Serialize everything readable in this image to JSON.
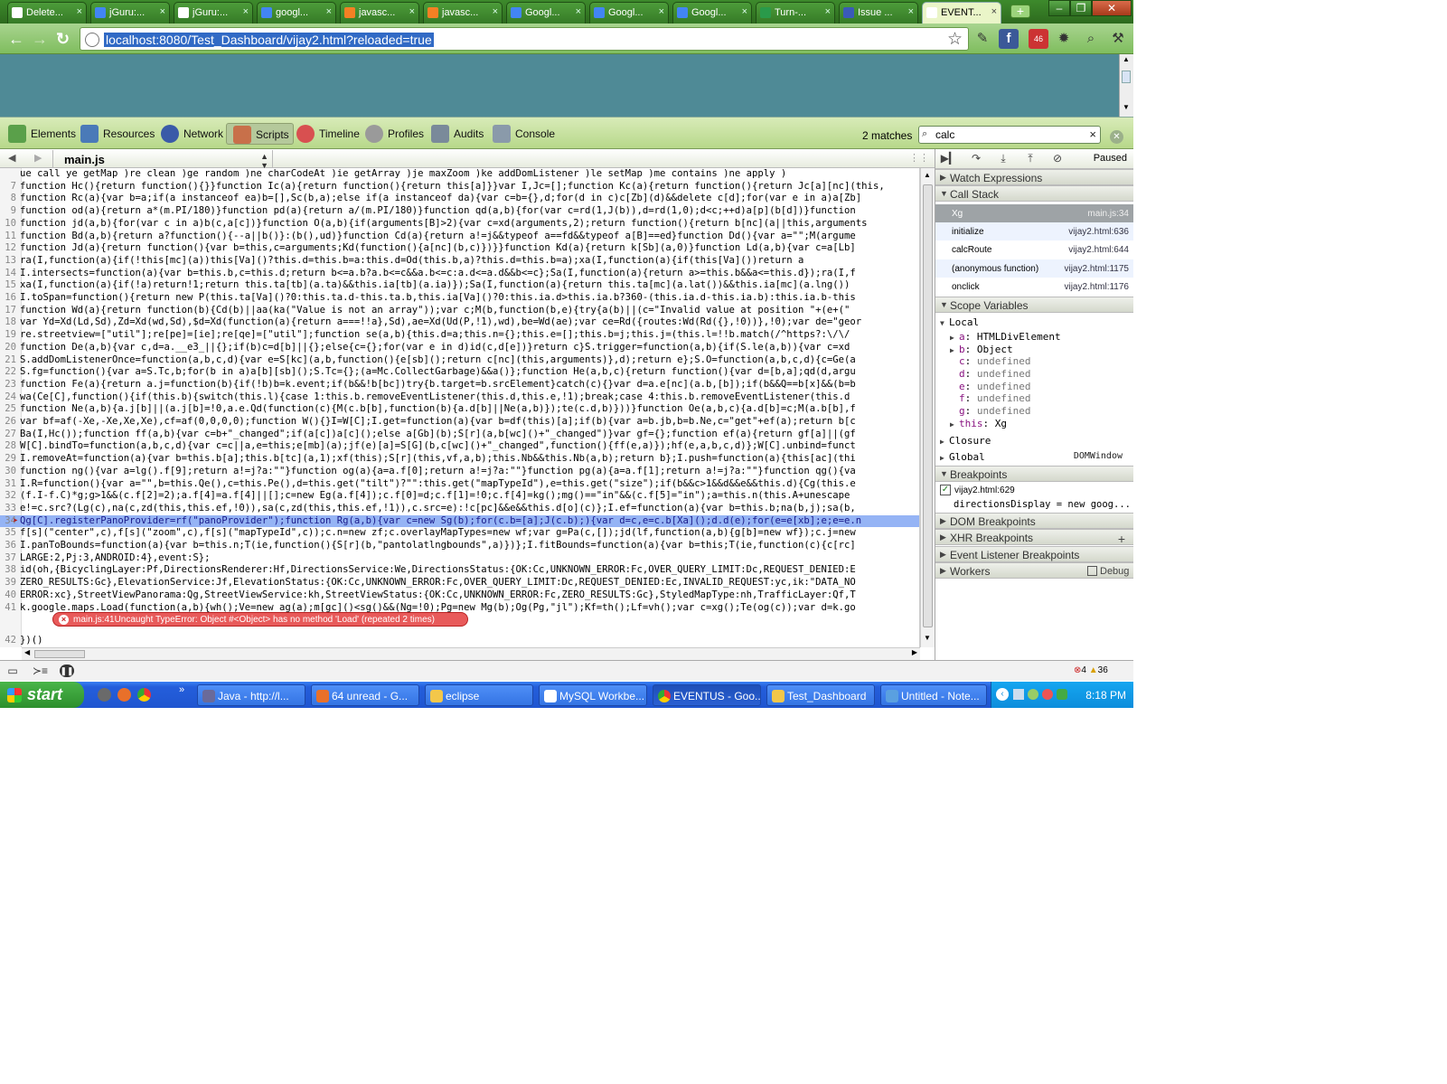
{
  "browser": {
    "tabs": [
      {
        "title": "Delete...",
        "icon": "page-icon",
        "color": "#ffffff",
        "active": false
      },
      {
        "title": "jGuru:...",
        "icon": "google-icon",
        "color": "#4285f4",
        "active": false
      },
      {
        "title": "jGuru:...",
        "icon": "page-icon",
        "color": "#ffffff",
        "active": false
      },
      {
        "title": "googl...",
        "icon": "google-icon",
        "color": "#4285f4",
        "active": false
      },
      {
        "title": "javasc...",
        "icon": "stackoverflow-icon",
        "color": "#f48024",
        "active": false
      },
      {
        "title": "javasc...",
        "icon": "stackoverflow-icon",
        "color": "#f48024",
        "active": false
      },
      {
        "title": "Googl...",
        "icon": "google-icon",
        "color": "#4285f4",
        "active": false
      },
      {
        "title": "Googl...",
        "icon": "google-icon",
        "color": "#4285f4",
        "active": false
      },
      {
        "title": "Googl...",
        "icon": "google-icon",
        "color": "#4285f4",
        "active": false
      },
      {
        "title": "Turn-...",
        "icon": "plus-icon",
        "color": "#2a9a4a",
        "active": false
      },
      {
        "title": "Issue ...",
        "icon": "issue-icon",
        "color": "#3a5ab8",
        "active": false
      },
      {
        "title": "EVENT...",
        "icon": "page-icon",
        "color": "#ffffff",
        "active": true
      }
    ],
    "url": "localhost:8080/Test_Dashboard/vijay2.html?reloaded=true",
    "ext_badge": "46"
  },
  "devtools": {
    "panels": [
      "Elements",
      "Resources",
      "Network",
      "Scripts",
      "Timeline",
      "Profiles",
      "Audits",
      "Console"
    ],
    "selected_panel": "Scripts",
    "matches": "2 matches",
    "search_value": "calc",
    "file": "main.js",
    "code_lines": [
      {
        "n": "",
        "t": "ue  call ye  getMap )re  clean )ge  random )ne  charCodeAt )ie  getArray )je  maxZoom )ke  addDomListener )le  setMap )me  contains )ne  apply )"
      },
      {
        "n": "7",
        "t": "function Hc(){return function(){}}function Ic(a){return function(){return this[a]}}var I,Jc=[];function Kc(a){return function(){return Jc[a][nc](this,"
      },
      {
        "n": "8",
        "t": "function Rc(a){var b=a;if(a instanceof ea)b=[],Sc(b,a);else if(a instanceof da){var c=b={},d;for(d in c)c[Zb](d)&&delete c[d];for(var e in a)a[Zb]"
      },
      {
        "n": "9",
        "t": "function od(a){return a*(m.PI/180)}function pd(a){return a/(m.PI/180)}function qd(a,b){for(var c=rd(1,J(b)),d=rd(1,0);d<c;++d)a[p](b[d])}function"
      },
      {
        "n": "10",
        "t": "function jd(a,b){for(var c in a)b(c,a[c])}function O(a,b){if(arguments[B]>2){var c=xd(arguments,2);return function(){return b[nc](a||this,arguments"
      },
      {
        "n": "11",
        "t": "function Bd(a,b){return a?function(){--a||b()}:(b(),ud)}function Cd(a){return a!=j&&typeof a==fd&&typeof a[B]==ed}function Dd(){var a=\"\";M(argume"
      },
      {
        "n": "12",
        "t": "function Jd(a){return function(){var b=this,c=arguments;Kd(function(){a[nc](b,c)})}}function Kd(a){return k[Sb](a,0)}function Ld(a,b){var c=a[Lb]"
      },
      {
        "n": "13",
        "t": "ra(I,function(a){if(!this[mc](a))this[Va]()?this.d=this.b=a:this.d=Od(this.b,a)?this.d=this.b=a);xa(I,function(a){if(this[Va]())return a"
      },
      {
        "n": "14",
        "t": "I.intersects=function(a){var b=this.b,c=this.d;return b<=a.b?a.b<=c&&a.b<=c:a.d<=a.d&&b<=c};Sa(I,function(a){return a>=this.b&&a<=this.d});ra(I,f"
      },
      {
        "n": "15",
        "t": "xa(I,function(a){if(!a)return!1;return this.ta[tb](a.ta)&&this.ia[tb](a.ia)});Sa(I,function(a){return this.ta[mc](a.lat())&&this.ia[mc](a.lng())"
      },
      {
        "n": "16",
        "t": "I.toSpan=function(){return new P(this.ta[Va]()?0:this.ta.d-this.ta.b,this.ia[Va]()?0:this.ia.d>this.ia.b?360-(this.ia.d-this.ia.b):this.ia.b-this"
      },
      {
        "n": "17",
        "t": "function Wd(a){return function(b){Cd(b)||aa(ka(\"Value is not an array\"));var c;M(b,function(b,e){try{a(b)||(c=\"Invalid value at position \"+(e+(\""
      },
      {
        "n": "18",
        "t": "var Yd=Xd(Ld,Sd),Zd=Xd(wd,Sd),$d=Xd(function(a){return a===!!a},Sd),ae=Xd(Ud(P,!1),wd),be=Wd(ae);var ce=Rd({routes:Wd(Rd({},!0))},!0);var de=\"geor"
      },
      {
        "n": "19",
        "t": "re.streetview=[\"util\"];re[pe]=[ie];re[qe]=[\"util\"];function se(a,b){this.d=a;this.n={};this.e=[];this.b=j;this.j=(this.l=!!b.match(/^https?:\\/\\/"
      },
      {
        "n": "20",
        "t": "function De(a,b){var c,d=a.__e3_||{};if(b)c=d[b]||{};else{c={};for(var e in d)id(c,d[e])}return c}S.trigger=function(a,b){if(S.le(a,b)){var c=xd"
      },
      {
        "n": "21",
        "t": "S.addDomListenerOnce=function(a,b,c,d){var e=S[kc](a,b,function(){e[sb]();return c[nc](this,arguments)},d);return e};S.O=function(a,b,c,d){c=Ge(a"
      },
      {
        "n": "22",
        "t": "S.fg=function(){var a=S.Tc,b;for(b in a)a[b][sb]();S.Tc={};(a=Mc.CollectGarbage)&&a()};function He(a,b,c){return function(){var d=[b,a];qd(d,argu"
      },
      {
        "n": "23",
        "t": "function Fe(a){return a.j=function(b){if(!b)b=k.event;if(b&&!b[bc])try{b.target=b.srcElement}catch(c){}var d=a.e[nc](a.b,[b]);if(b&&Q==b[x]&&(b=b"
      },
      {
        "n": "24",
        "t": "wa(Ce[C],function(){if(this.b){switch(this.l){case 1:this.b.removeEventListener(this.d,this.e,!1);break;case 4:this.b.removeEventListener(this.d"
      },
      {
        "n": "25",
        "t": "function Ne(a,b){a.j[b]||(a.j[b]=!0,a.e.Qd(function(c){M(c.b[b],function(b){a.d[b]||Ne(a,b)});te(c.d,b)}))}function Oe(a,b,c){a.d[b]=c;M(a.b[b],f"
      },
      {
        "n": "26",
        "t": "var bf=af(-Xe,-Xe,Xe,Xe),cf=af(0,0,0,0);function W(){}I=W[C];I.get=function(a){var b=df(this)[a];if(b){var a=b.jb,b=b.Ne,c=\"get\"+ef(a);return b[c"
      },
      {
        "n": "27",
        "t": "Ba(I,Hc());function ff(a,b){var c=b+\"_changed\";if(a[c])a[c]();else a[Gb](b);S[r](a,b[wc]()+\"_changed\")}var gf={};function ef(a){return gf[a]||(gf"
      },
      {
        "n": "28",
        "t": "W[C].bindTo=function(a,b,c,d){var c=c||a,e=this;e[mb](a);jf(e)[a]=S[G](b,c[wc]()+\"_changed\",function(){ff(e,a)});hf(e,a,b,c,d)};W[C].unbind=funct"
      },
      {
        "n": "29",
        "t": "I.removeAt=function(a){var b=this.b[a];this.b[tc](a,1);xf(this);S[r](this,vf,a,b);this.Nb&&this.Nb(a,b);return b};I.push=function(a){this[ac](thi"
      },
      {
        "n": "30",
        "t": "function ng(){var a=lg().f[9];return a!=j?a:\"\"}function og(a){a=a.f[0];return a!=j?a:\"\"}function pg(a){a=a.f[1];return a!=j?a:\"\"}function qg(){va"
      },
      {
        "n": "31",
        "t": "I.R=function(){var a=\"\",b=this.Qe(),c=this.Pe(),d=this.get(\"tilt\")?\"\":this.get(\"mapTypeId\"),e=this.get(\"size\");if(b&&c>1&&d&&e&&this.d){Cg(this.e"
      },
      {
        "n": "32",
        "t": "(f.I-f.C)*g;g>1&&(c.f[2]=2);a.f[4]=a.f[4]||[];c=new Eg(a.f[4]);c.f[0]=d;c.f[1]=!0;c.f[4]=kg();mg()==\"in\"&&(c.f[5]=\"in\");a=this.n(this.A+unescape"
      },
      {
        "n": "33",
        "t": "e!=c.src?(Lg(c),na(c,zd(this,this.ef,!0)),sa(c,zd(this,this.ef,!1)),c.src=e):!c[pc]&&e&&this.d[o](c)};I.ef=function(a){var b=this.b;na(b,j);sa(b,"
      },
      {
        "n": "34",
        "t": "Qg[C].registerPanoProvider=rf(\"panoProvider\");function Rg(a,b){var c=new Sg(b);for(c.b=[a];J(c.b);){var d=c,e=c.b[Xa]();d.d(e);for(e=e[xb];e;e=e.n",
        "hl": true
      },
      {
        "n": "35",
        "t": "f[s](\"center\",c),f[s](\"zoom\",c),f[s](\"mapTypeId\",c));c.n=new zf;c.overlayMapTypes=new wf;var g=Pa(c,[]);jd(lf,function(a,b){g[b]=new wf});c.j=new"
      },
      {
        "n": "36",
        "t": "I.panToBounds=function(a){var b=this.n;T(ie,function(){S[r](b,\"pantolatlngbounds\",a)})};I.fitBounds=function(a){var b=this;T(ie,function(c){c[rc]"
      },
      {
        "n": "37",
        "t": "LARGE:2,Pj:3,ANDROID:4},event:S};"
      },
      {
        "n": "38",
        "t": "id(oh,{BicyclingLayer:Pf,DirectionsRenderer:Hf,DirectionsService:We,DirectionsStatus:{OK:Cc,UNKNOWN_ERROR:Fc,OVER_QUERY_LIMIT:Dc,REQUEST_DENIED:E"
      },
      {
        "n": "39",
        "t": "ZERO_RESULTS:Gc},ElevationService:Jf,ElevationStatus:{OK:Cc,UNKNOWN_ERROR:Fc,OVER_QUERY_LIMIT:Dc,REQUEST_DENIED:Ec,INVALID_REQUEST:yc,ik:\"DATA_NO"
      },
      {
        "n": "40",
        "t": "ERROR:xc},StreetViewPanorama:Qg,StreetViewService:kh,StreetViewStatus:{OK:Cc,UNKNOWN_ERROR:Fc,ZERO_RESULTS:Gc},StyledMapType:nh,TrafficLayer:Qf,T"
      },
      {
        "n": "41",
        "t": "k.google.maps.Load(function(a,b){wh();Ve=new ag(a);m[gc]()<sg()&&(Ng=!0);Pg=new Mg(b);Og(Pg,\"jl\");Kf=th();Lf=vh();var c=xg();Te(og(c));var d=k.go"
      },
      {
        "n": "42",
        "t": "})()"
      }
    ],
    "error_message": "main.js:41Uncaught TypeError: Object #<Object> has no method 'Load' (repeated 2 times)",
    "paused_label": "Paused",
    "sections": {
      "watch": "Watch Expressions",
      "callstack": "Call Stack",
      "scope": "Scope Variables",
      "breakpoints": "Breakpoints",
      "dom_bp": "DOM Breakpoints",
      "xhr_bp": "XHR Breakpoints",
      "event_bp": "Event Listener Breakpoints",
      "workers": "Workers",
      "debug_label": "Debug"
    },
    "call_stack": [
      {
        "fn": "Xg",
        "loc": "main.js:34",
        "selected": true
      },
      {
        "fn": "initialize",
        "loc": "vijay2.html:636"
      },
      {
        "fn": "calcRoute",
        "loc": "vijay2.html:644"
      },
      {
        "fn": "(anonymous function)",
        "loc": "vijay2.html:1175"
      },
      {
        "fn": "onclick",
        "loc": "vijay2.html:1176"
      }
    ],
    "scope": {
      "local": "Local",
      "vars": [
        {
          "k": "a",
          "v": "HTMLDivElement",
          "expandable": true
        },
        {
          "k": "b",
          "v": "Object",
          "expandable": true
        },
        {
          "k": "c",
          "v": "undefined"
        },
        {
          "k": "d",
          "v": "undefined"
        },
        {
          "k": "e",
          "v": "undefined"
        },
        {
          "k": "f",
          "v": "undefined"
        },
        {
          "k": "g",
          "v": "undefined"
        },
        {
          "k": "this",
          "v": "Xg",
          "expandable": true
        }
      ],
      "closure": "Closure",
      "global": "Global",
      "global_value": "DOMWindow"
    },
    "breakpoint": {
      "file": "vijay2.html:629",
      "code": "directionsDisplay = new goog..."
    },
    "error_count": "4",
    "warning_count": "36"
  },
  "taskbar": {
    "start_label": "start",
    "items": [
      {
        "label": "Java - http://l...",
        "color": "#6a6a9a"
      },
      {
        "label": "64 unread - G...",
        "color": "#e8702a"
      },
      {
        "label": "eclipse",
        "color": "#f3c74a"
      },
      {
        "label": "MySQL Workbe...",
        "color": "#fff"
      },
      {
        "label": "EVENTUS - Goo...",
        "color": "#4caf50",
        "active": true
      },
      {
        "label": "Test_Dashboard",
        "color": "#f3c74a"
      },
      {
        "label": "Untitled - Note...",
        "color": "#5aa0e0"
      }
    ],
    "clock": "8:18 PM"
  },
  "colors": {
    "chrome_green": "#3d8a2c",
    "page_bg": "#4f8a96",
    "devtools_bar": "#c7e2a1",
    "highlight_line": "#95b4f5",
    "error_bubble": "#e85a5a",
    "taskbar_blue": "#245edb"
  }
}
